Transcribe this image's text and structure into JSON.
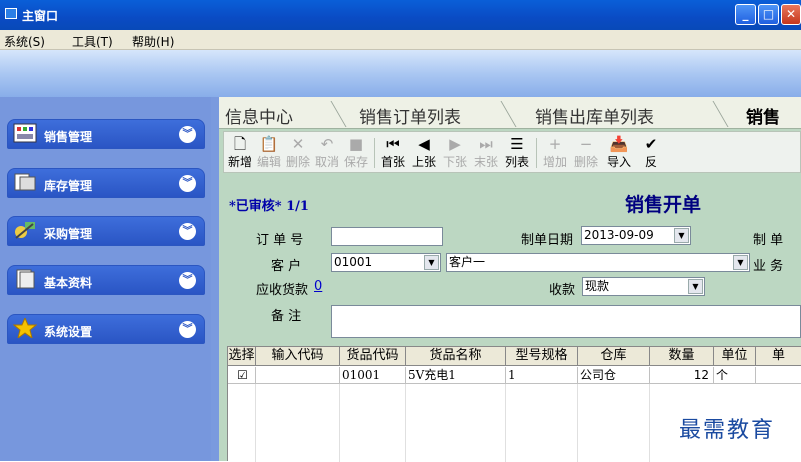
{
  "window": {
    "title": "主窗口"
  },
  "menu": {
    "items": [
      "系统(S)",
      "工具(T)",
      "帮助(H)"
    ]
  },
  "sidebar": {
    "items": [
      {
        "label": "销售管理",
        "icon": "grid-icon"
      },
      {
        "label": "库存管理",
        "icon": "folder-icon"
      },
      {
        "label": "采购管理",
        "icon": "tools-icon"
      },
      {
        "label": "基本资料",
        "icon": "document-icon"
      },
      {
        "label": "系统设置",
        "icon": "star-icon"
      }
    ]
  },
  "tabs": [
    "信息中心",
    "销售订单列表",
    "销售出库单列表",
    "销售"
  ],
  "toolbar": {
    "buttons": [
      {
        "label": "新增",
        "enabled": true,
        "icon": "new-doc-icon"
      },
      {
        "label": "编辑",
        "enabled": false,
        "icon": "edit-icon"
      },
      {
        "label": "删除",
        "enabled": false,
        "icon": "delete-icon"
      },
      {
        "label": "取消",
        "enabled": false,
        "icon": "undo-icon"
      },
      {
        "label": "保存",
        "enabled": false,
        "icon": "save-icon"
      },
      {
        "label": "首张",
        "enabled": true,
        "icon": "first-icon"
      },
      {
        "label": "上张",
        "enabled": true,
        "icon": "prev-icon"
      },
      {
        "label": "下张",
        "enabled": false,
        "icon": "next-icon"
      },
      {
        "label": "末张",
        "enabled": false,
        "icon": "last-icon"
      },
      {
        "label": "列表",
        "enabled": true,
        "icon": "list-icon"
      },
      {
        "label": "增加",
        "enabled": false,
        "icon": "plus-icon"
      },
      {
        "label": "删除",
        "enabled": false,
        "icon": "minus-icon"
      },
      {
        "label": "导入",
        "enabled": true,
        "icon": "import-icon"
      },
      {
        "label": "反",
        "enabled": true,
        "icon": "check-icon"
      }
    ]
  },
  "form": {
    "status": "*已审核* 1/1",
    "title": "销售开单",
    "order_no_label": "订 单 号",
    "order_no_value": "",
    "date_label": "制单日期",
    "date_value": "2013-09-09",
    "maker_label": "制 单",
    "customer_label": "客 户",
    "customer_code": "01001",
    "customer_name": "客户一",
    "salesman_label": "业 务",
    "receivable_label": "应收货款",
    "receivable_value": "0",
    "payment_label": "收款",
    "payment_value": "现款",
    "remark_label": "备 注",
    "remark_value": ""
  },
  "grid": {
    "headers": [
      "选择",
      "输入代码",
      "货品代码",
      "货品名称",
      "型号规格",
      "仓库",
      "数量",
      "单位",
      "单"
    ],
    "rows": [
      {
        "select": "☑",
        "input_code": "",
        "product_code": "01001",
        "product_name": "5V充电1",
        "spec": "1",
        "warehouse": "公司仓",
        "qty": "12",
        "unit": "个",
        "price": ""
      }
    ]
  },
  "watermark": "最需教育"
}
